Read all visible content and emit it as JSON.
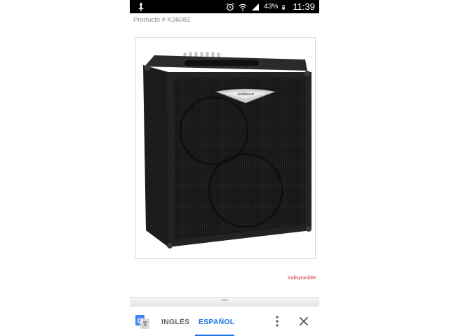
{
  "status_bar": {
    "battery_percent": "43%",
    "time": "11:39",
    "icons": [
      "notification-icon",
      "alarm-icon",
      "wifi-icon",
      "signal-icon",
      "battery-icon"
    ]
  },
  "product": {
    "code": "Producto # K36082",
    "image": "bass-amplifier-combo-photo",
    "brand_logo": "Ashdown",
    "status": "Indisponible"
  },
  "translate_bar": {
    "source_lang": "INGLÉS",
    "target_lang": "ESPAÑOL",
    "active": "ESPAÑOL",
    "icons": [
      "google-translate-icon",
      "more-options-icon",
      "close-icon"
    ]
  },
  "colors": {
    "accent": "#1a73e8",
    "status_red": "#d0263a",
    "status_bar_bg": "#000000"
  }
}
